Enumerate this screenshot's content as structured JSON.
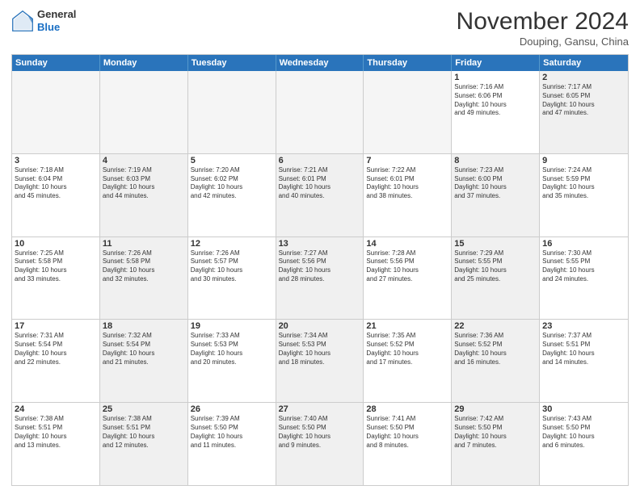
{
  "header": {
    "logo_general": "General",
    "logo_blue": "Blue",
    "month": "November 2024",
    "location": "Douping, Gansu, China"
  },
  "weekdays": [
    "Sunday",
    "Monday",
    "Tuesday",
    "Wednesday",
    "Thursday",
    "Friday",
    "Saturday"
  ],
  "rows": [
    [
      {
        "day": "",
        "text": "",
        "shaded": false,
        "empty": true
      },
      {
        "day": "",
        "text": "",
        "shaded": false,
        "empty": true
      },
      {
        "day": "",
        "text": "",
        "shaded": false,
        "empty": true
      },
      {
        "day": "",
        "text": "",
        "shaded": false,
        "empty": true
      },
      {
        "day": "",
        "text": "",
        "shaded": false,
        "empty": true
      },
      {
        "day": "1",
        "text": "Sunrise: 7:16 AM\nSunset: 6:06 PM\nDaylight: 10 hours\nand 49 minutes.",
        "shaded": false,
        "empty": false
      },
      {
        "day": "2",
        "text": "Sunrise: 7:17 AM\nSunset: 6:05 PM\nDaylight: 10 hours\nand 47 minutes.",
        "shaded": true,
        "empty": false
      }
    ],
    [
      {
        "day": "3",
        "text": "Sunrise: 7:18 AM\nSunset: 6:04 PM\nDaylight: 10 hours\nand 45 minutes.",
        "shaded": false,
        "empty": false
      },
      {
        "day": "4",
        "text": "Sunrise: 7:19 AM\nSunset: 6:03 PM\nDaylight: 10 hours\nand 44 minutes.",
        "shaded": true,
        "empty": false
      },
      {
        "day": "5",
        "text": "Sunrise: 7:20 AM\nSunset: 6:02 PM\nDaylight: 10 hours\nand 42 minutes.",
        "shaded": false,
        "empty": false
      },
      {
        "day": "6",
        "text": "Sunrise: 7:21 AM\nSunset: 6:01 PM\nDaylight: 10 hours\nand 40 minutes.",
        "shaded": true,
        "empty": false
      },
      {
        "day": "7",
        "text": "Sunrise: 7:22 AM\nSunset: 6:01 PM\nDaylight: 10 hours\nand 38 minutes.",
        "shaded": false,
        "empty": false
      },
      {
        "day": "8",
        "text": "Sunrise: 7:23 AM\nSunset: 6:00 PM\nDaylight: 10 hours\nand 37 minutes.",
        "shaded": true,
        "empty": false
      },
      {
        "day": "9",
        "text": "Sunrise: 7:24 AM\nSunset: 5:59 PM\nDaylight: 10 hours\nand 35 minutes.",
        "shaded": false,
        "empty": false
      }
    ],
    [
      {
        "day": "10",
        "text": "Sunrise: 7:25 AM\nSunset: 5:58 PM\nDaylight: 10 hours\nand 33 minutes.",
        "shaded": false,
        "empty": false
      },
      {
        "day": "11",
        "text": "Sunrise: 7:26 AM\nSunset: 5:58 PM\nDaylight: 10 hours\nand 32 minutes.",
        "shaded": true,
        "empty": false
      },
      {
        "day": "12",
        "text": "Sunrise: 7:26 AM\nSunset: 5:57 PM\nDaylight: 10 hours\nand 30 minutes.",
        "shaded": false,
        "empty": false
      },
      {
        "day": "13",
        "text": "Sunrise: 7:27 AM\nSunset: 5:56 PM\nDaylight: 10 hours\nand 28 minutes.",
        "shaded": true,
        "empty": false
      },
      {
        "day": "14",
        "text": "Sunrise: 7:28 AM\nSunset: 5:56 PM\nDaylight: 10 hours\nand 27 minutes.",
        "shaded": false,
        "empty": false
      },
      {
        "day": "15",
        "text": "Sunrise: 7:29 AM\nSunset: 5:55 PM\nDaylight: 10 hours\nand 25 minutes.",
        "shaded": true,
        "empty": false
      },
      {
        "day": "16",
        "text": "Sunrise: 7:30 AM\nSunset: 5:55 PM\nDaylight: 10 hours\nand 24 minutes.",
        "shaded": false,
        "empty": false
      }
    ],
    [
      {
        "day": "17",
        "text": "Sunrise: 7:31 AM\nSunset: 5:54 PM\nDaylight: 10 hours\nand 22 minutes.",
        "shaded": false,
        "empty": false
      },
      {
        "day": "18",
        "text": "Sunrise: 7:32 AM\nSunset: 5:54 PM\nDaylight: 10 hours\nand 21 minutes.",
        "shaded": true,
        "empty": false
      },
      {
        "day": "19",
        "text": "Sunrise: 7:33 AM\nSunset: 5:53 PM\nDaylight: 10 hours\nand 20 minutes.",
        "shaded": false,
        "empty": false
      },
      {
        "day": "20",
        "text": "Sunrise: 7:34 AM\nSunset: 5:53 PM\nDaylight: 10 hours\nand 18 minutes.",
        "shaded": true,
        "empty": false
      },
      {
        "day": "21",
        "text": "Sunrise: 7:35 AM\nSunset: 5:52 PM\nDaylight: 10 hours\nand 17 minutes.",
        "shaded": false,
        "empty": false
      },
      {
        "day": "22",
        "text": "Sunrise: 7:36 AM\nSunset: 5:52 PM\nDaylight: 10 hours\nand 16 minutes.",
        "shaded": true,
        "empty": false
      },
      {
        "day": "23",
        "text": "Sunrise: 7:37 AM\nSunset: 5:51 PM\nDaylight: 10 hours\nand 14 minutes.",
        "shaded": false,
        "empty": false
      }
    ],
    [
      {
        "day": "24",
        "text": "Sunrise: 7:38 AM\nSunset: 5:51 PM\nDaylight: 10 hours\nand 13 minutes.",
        "shaded": false,
        "empty": false
      },
      {
        "day": "25",
        "text": "Sunrise: 7:38 AM\nSunset: 5:51 PM\nDaylight: 10 hours\nand 12 minutes.",
        "shaded": true,
        "empty": false
      },
      {
        "day": "26",
        "text": "Sunrise: 7:39 AM\nSunset: 5:50 PM\nDaylight: 10 hours\nand 11 minutes.",
        "shaded": false,
        "empty": false
      },
      {
        "day": "27",
        "text": "Sunrise: 7:40 AM\nSunset: 5:50 PM\nDaylight: 10 hours\nand 9 minutes.",
        "shaded": true,
        "empty": false
      },
      {
        "day": "28",
        "text": "Sunrise: 7:41 AM\nSunset: 5:50 PM\nDaylight: 10 hours\nand 8 minutes.",
        "shaded": false,
        "empty": false
      },
      {
        "day": "29",
        "text": "Sunrise: 7:42 AM\nSunset: 5:50 PM\nDaylight: 10 hours\nand 7 minutes.",
        "shaded": true,
        "empty": false
      },
      {
        "day": "30",
        "text": "Sunrise: 7:43 AM\nSunset: 5:50 PM\nDaylight: 10 hours\nand 6 minutes.",
        "shaded": false,
        "empty": false
      }
    ]
  ]
}
